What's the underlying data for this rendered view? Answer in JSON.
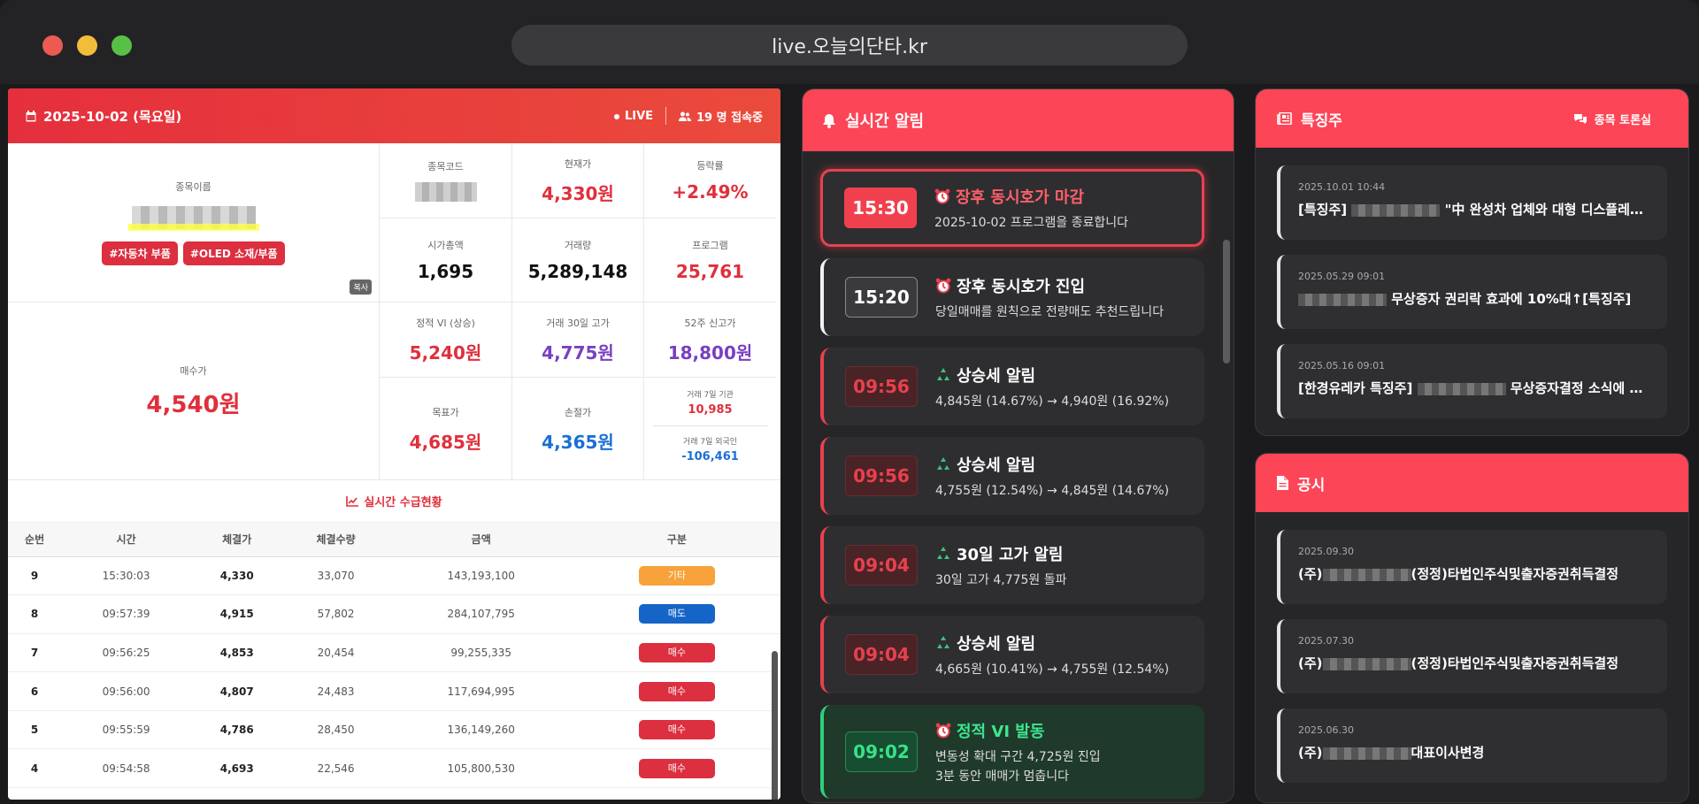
{
  "browser": {
    "url": "live.오늘의단타.kr"
  },
  "left": {
    "date": "2025-10-02 (목요일)",
    "live_label": "LIVE",
    "viewers": "19 명 접속중",
    "stock_name_label": "종목이름",
    "tags": [
      "#자동차 부품",
      "#OLED 소재/부품"
    ],
    "copy_label": "복사",
    "buy_price_label": "매수가",
    "buy_price": "4,540원",
    "cells": {
      "code_label": "종목코드",
      "current_label": "현재가",
      "current": "4,330원",
      "change_label": "등락률",
      "change": "+2.49%",
      "marketcap_label": "시가총액",
      "marketcap": "1,695",
      "volume_label": "거래량",
      "volume": "5,289,148",
      "program_label": "프로그램",
      "program": "25,761",
      "vi_label": "정적 VI (상승)",
      "vi": "5,240원",
      "high30_label": "거래 30일 고가",
      "high30": "4,775원",
      "high52_label": "52주 신고가",
      "high52": "18,800원",
      "target_label": "목표가",
      "target": "4,685원",
      "stop_label": "손절가",
      "stop": "4,365원",
      "inst7_label": "거래 7일 기관",
      "inst7": "10,985",
      "foreign7_label": "거래 7일 외국인",
      "foreign7": "-106,461"
    },
    "flow_title": "실시간 수급현황",
    "columns": [
      "순번",
      "시간",
      "체결가",
      "체결수량",
      "금액",
      "구분"
    ],
    "rows": [
      {
        "no": "9",
        "time": "15:30:03",
        "price": "4,330",
        "qty": "33,070",
        "amount": "143,193,100",
        "type": "기타",
        "kind": "etc"
      },
      {
        "no": "8",
        "time": "09:57:39",
        "price": "4,915",
        "qty": "57,802",
        "amount": "284,107,795",
        "type": "매도",
        "kind": "sell"
      },
      {
        "no": "7",
        "time": "09:56:25",
        "price": "4,853",
        "qty": "20,454",
        "amount": "99,255,335",
        "type": "매수",
        "kind": "buy"
      },
      {
        "no": "6",
        "time": "09:56:00",
        "price": "4,807",
        "qty": "24,483",
        "amount": "117,694,995",
        "type": "매수",
        "kind": "buy"
      },
      {
        "no": "5",
        "time": "09:55:59",
        "price": "4,786",
        "qty": "28,450",
        "amount": "136,149,260",
        "type": "매수",
        "kind": "buy"
      },
      {
        "no": "4",
        "time": "09:54:58",
        "price": "4,693",
        "qty": "22,546",
        "amount": "105,800,530",
        "type": "매수",
        "kind": "buy"
      }
    ]
  },
  "alerts_panel": {
    "title": "실시간 알림",
    "items": [
      {
        "time": "15:30",
        "title": "장후 동시호가 마감",
        "desc": "2025-10-02 프로그램을 종료합니다",
        "icon": "alarm-clock-icon"
      },
      {
        "time": "15:20",
        "title": "장후 동시호가 진입",
        "desc": "당일매매를 원칙으로 전량매도 추천드립니다",
        "icon": "alarm-clock-icon"
      },
      {
        "time": "09:56",
        "title": "상승세 알림",
        "desc": "4,845원 (14.67%) → 4,940원 (16.92%)",
        "icon": "recycle-icon"
      },
      {
        "time": "09:56",
        "title": "상승세 알림",
        "desc": "4,755원 (12.54%) → 4,845원 (14.67%)",
        "icon": "recycle-icon"
      },
      {
        "time": "09:04",
        "title": "30일 고가 알림",
        "desc": "30일 고가 4,775원 돌파",
        "icon": "recycle-icon"
      },
      {
        "time": "09:04",
        "title": "상승세 알림",
        "desc": "4,665원 (10.41%) → 4,755원 (12.54%)",
        "icon": "recycle-icon"
      },
      {
        "time": "09:02",
        "title": "정적 VI 발동",
        "desc": "변동성 확대 구간 4,725원 진입",
        "desc2": "3분 동안 매매가 멈춥니다",
        "icon": "alarm-clock-icon"
      }
    ]
  },
  "featured_panel": {
    "title": "특징주",
    "link": "종목 토론실",
    "items": [
      {
        "date": "2025.10.01 10:44",
        "prefix": "[특징주] ",
        "suffix": " \"中 완성차 업체와 대형 디스플레…"
      },
      {
        "date": "2025.05.29 09:01",
        "prefix": "",
        "suffix": " 무상증자 권리락 효과에 10%대↑[특징주]"
      },
      {
        "date": "2025.05.16 09:01",
        "prefix": "[한경유레카 특징주] ",
        "suffix": " 무상증자결정 소식에 …"
      }
    ]
  },
  "notice_panel": {
    "title": "공시",
    "items": [
      {
        "date": "2025.09.30",
        "prefix": "(주)",
        "suffix": "(정정)타법인주식및출자증권취득결정"
      },
      {
        "date": "2025.07.30",
        "prefix": "(주)",
        "suffix": "(정정)타법인주식및출자증권취득결정"
      },
      {
        "date": "2025.06.30",
        "prefix": "(주)",
        "suffix": "대표이사변경"
      }
    ]
  },
  "colors": {
    "accent": "#fc4556",
    "buy": "#dc2f3f",
    "sell": "#1565c8",
    "etc": "#f7a23a"
  }
}
